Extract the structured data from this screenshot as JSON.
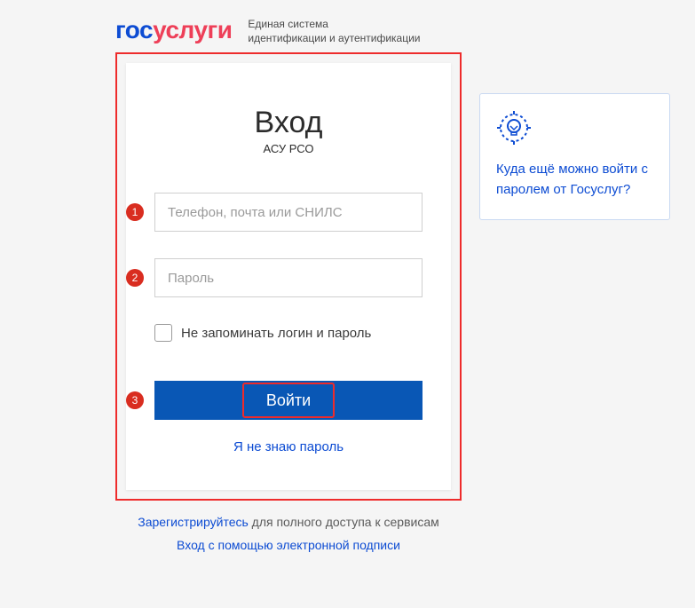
{
  "header": {
    "logo_part1": "гос",
    "logo_part2": "услуги",
    "tagline_line1": "Единая система",
    "tagline_line2": "идентификации и аутентификации"
  },
  "login": {
    "title": "Вход",
    "subtitle": "АСУ РСО",
    "username_placeholder": "Телефон, почта или СНИЛС",
    "password_placeholder": "Пароль",
    "remember_label": "Не запоминать логин и пароль",
    "submit_label": "Войти",
    "forgot_label": "Я не знаю пароль"
  },
  "markers": {
    "m1": "1",
    "m2": "2",
    "m3": "3"
  },
  "footer": {
    "register_link": "Зарегистрируйтесь",
    "register_rest": " для полного доступа к сервисам",
    "signature_link": "Вход с помощью электронной подписи"
  },
  "side": {
    "link_text": "Куда ещё можно войти с паролем от Госуслуг?"
  }
}
